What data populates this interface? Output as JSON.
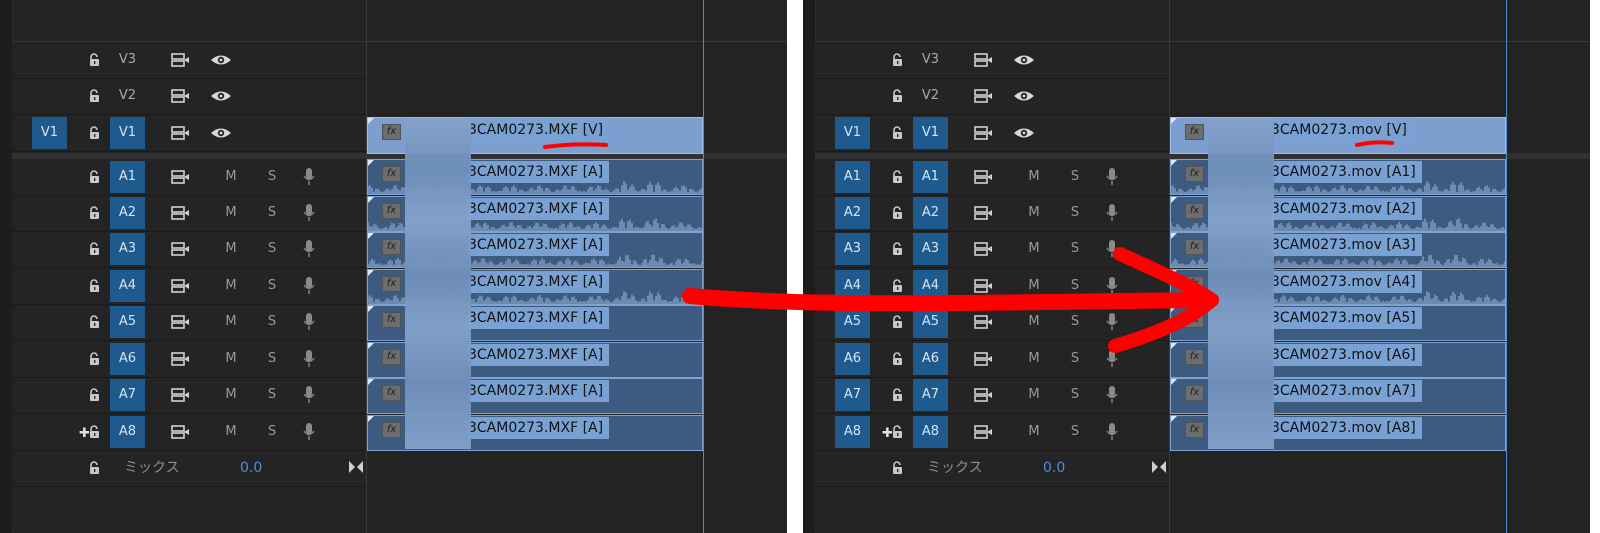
{
  "left_panel": {
    "tracks": [
      {
        "source": "",
        "name": "V3",
        "kind": "video",
        "active": false
      },
      {
        "source": "",
        "name": "V2",
        "kind": "video",
        "active": false
      },
      {
        "source": "V1",
        "name": "V1",
        "kind": "video",
        "active": true
      },
      {
        "source": "",
        "name": "A1",
        "kind": "audio",
        "active": true,
        "m": "M",
        "s": "S"
      },
      {
        "source": "",
        "name": "A2",
        "kind": "audio",
        "active": true,
        "m": "M",
        "s": "S"
      },
      {
        "source": "",
        "name": "A3",
        "kind": "audio",
        "active": true,
        "m": "M",
        "s": "S"
      },
      {
        "source": "",
        "name": "A4",
        "kind": "audio",
        "active": true,
        "m": "M",
        "s": "S"
      },
      {
        "source": "",
        "name": "A5",
        "kind": "audio",
        "active": true,
        "m": "M",
        "s": "S"
      },
      {
        "source": "",
        "name": "A6",
        "kind": "audio",
        "active": true,
        "m": "M",
        "s": "S"
      },
      {
        "source": "",
        "name": "A7",
        "kind": "audio",
        "active": true,
        "m": "M",
        "s": "S"
      },
      {
        "source": "",
        "name": "A8",
        "kind": "audio",
        "active": true,
        "m": "M",
        "s": "S"
      }
    ],
    "mix_label": "ミックス",
    "mix_value": "0.0",
    "clips": [
      "3CAM0273.MXF [V]",
      "3CAM0273.MXF [A]",
      "3CAM0273.MXF [A]",
      "3CAM0273.MXF [A]",
      "3CAM0273.MXF [A]",
      "3CAM0273.MXF [A]",
      "3CAM0273.MXF [A]",
      "3CAM0273.MXF [A]",
      "3CAM0273.MXF [A]"
    ],
    "fx_label": "fx"
  },
  "right_panel": {
    "tracks": [
      {
        "source": "",
        "name": "V3",
        "kind": "video",
        "active": false
      },
      {
        "source": "",
        "name": "V2",
        "kind": "video",
        "active": false
      },
      {
        "source": "V1",
        "name": "V1",
        "kind": "video",
        "active": true
      },
      {
        "source": "A1",
        "name": "A1",
        "kind": "audio",
        "active": true,
        "m": "M",
        "s": "S"
      },
      {
        "source": "A2",
        "name": "A2",
        "kind": "audio",
        "active": true,
        "m": "M",
        "s": "S"
      },
      {
        "source": "A3",
        "name": "A3",
        "kind": "audio",
        "active": true,
        "m": "M",
        "s": "S"
      },
      {
        "source": "A4",
        "name": "A4",
        "kind": "audio",
        "active": true,
        "m": "M",
        "s": "S"
      },
      {
        "source": "A5",
        "name": "A5",
        "kind": "audio",
        "active": true,
        "m": "M",
        "s": "S"
      },
      {
        "source": "A6",
        "name": "A6",
        "kind": "audio",
        "active": true,
        "m": "M",
        "s": "S"
      },
      {
        "source": "A7",
        "name": "A7",
        "kind": "audio",
        "active": true,
        "m": "M",
        "s": "S"
      },
      {
        "source": "A8",
        "name": "A8",
        "kind": "audio",
        "active": true,
        "m": "M",
        "s": "S"
      }
    ],
    "mix_label": "ミックス",
    "mix_value": "0.0",
    "clips": [
      "3CAM0273.mov [V]",
      "3CAM0273.mov [A1]",
      "3CAM0273.mov [A2]",
      "3CAM0273.mov [A3]",
      "3CAM0273.mov [A4]",
      "3CAM0273.mov [A5]",
      "3CAM0273.mov [A6]",
      "3CAM0273.mov [A7]",
      "3CAM0273.mov [A8]"
    ],
    "fx_label": "fx"
  },
  "colors": {
    "annotation": "#ff0000",
    "accent": "#1f5a8e",
    "playhead": "#4e8bd3"
  }
}
